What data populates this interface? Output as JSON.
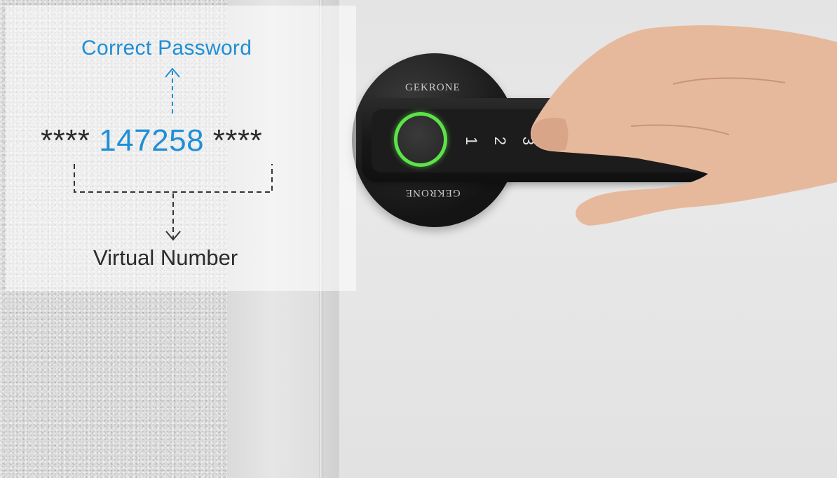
{
  "annotation": {
    "top_label": "Correct Password",
    "mask_left": "****",
    "password": "147258",
    "mask_right": "****",
    "bottom_label": "Virtual Number",
    "accent_color": "#1f8fd6"
  },
  "lock": {
    "brand": "GEKRONE",
    "keys": [
      "1",
      "2",
      "3"
    ],
    "fingerprint_ring_color": "#5de24a"
  }
}
